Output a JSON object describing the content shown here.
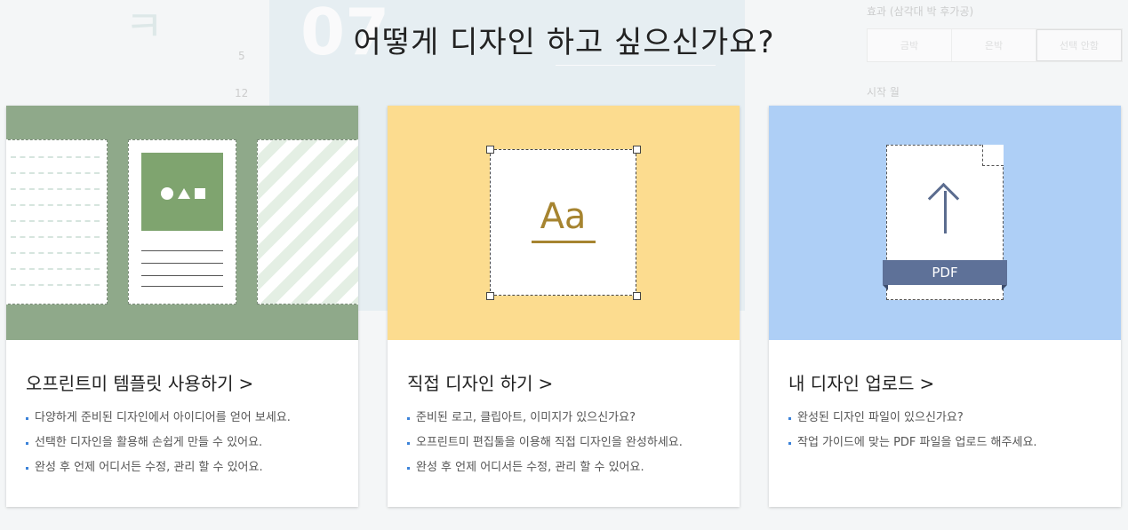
{
  "background": {
    "big_number": "07",
    "side_char": "ㅋ",
    "numbers": [
      "5",
      "12"
    ],
    "effect_label": "효과 (삼각대 박 후가공)",
    "effect_options": [
      "금박",
      "은박",
      "선택 안함"
    ],
    "start_label": "시작 월"
  },
  "heading": "어떻게 디자인 하고 싶으신가요?",
  "cards": [
    {
      "title": "오프린트미 템플릿 사용하기",
      "chevron": ">",
      "bullets": [
        "다양하게 준비된 디자인에서 아이디어를 얻어 보세요.",
        "선택한 디자인을 활용해 손쉽게 만들 수 있어요.",
        "완성 후 언제 어디서든 수정, 관리 할 수 있어요."
      ]
    },
    {
      "title": "직접 디자인 하기",
      "chevron": ">",
      "sample_text": "Aa",
      "bullets": [
        "준비된 로고, 클립아트, 이미지가 있으신가요?",
        "오프린트미 편집툴을 이용해 직접 디자인을 완성하세요.",
        "완성 후 언제 어디서든 수정, 관리 할 수 있어요."
      ]
    },
    {
      "title": "내 디자인 업로드",
      "chevron": ">",
      "file_label": "PDF",
      "bullets": [
        "완성된 디자인 파일이 있으신가요?",
        "작업 가이드에 맞는 PDF 파일을 업로드 해주세요."
      ]
    }
  ],
  "colors": {
    "card1_bg": "#8fa98a",
    "card2_bg": "#fcdc8f",
    "card3_bg": "#aecff6",
    "bullet": "#3b82d9",
    "accent_gold": "#a68430",
    "pdf_band": "#5e7198"
  }
}
